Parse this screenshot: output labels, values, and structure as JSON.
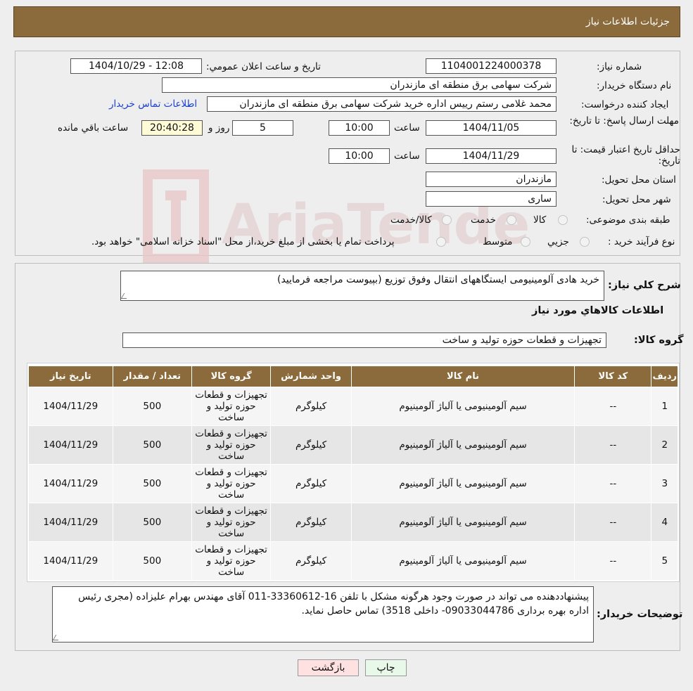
{
  "header": {
    "title": "جزئیات اطلاعات نیاز"
  },
  "form": {
    "need_number_label": "شماره نیاز:",
    "need_number": "1104001224000378",
    "announce_label": "تاریخ و ساعت اعلان عمومي:",
    "announce_value": "1404/10/29 - 12:08",
    "buyer_org_label": "نام دستگاه خريدار:",
    "buyer_org": "شرکت سهامی برق منطقه ای مازندران",
    "creator_label": "ايجاد کننده درخواست:",
    "creator": "محمد غلامی رستم رییس اداره خرید شرکت سهامی برق منطقه ای مازندران",
    "contact_link": "اطلاعات تماس خريدار",
    "reply_deadline_label": "مهلت ارسال پاسخ: تا تاريخ:",
    "reply_date": "1404/11/05",
    "time_label": "ساعت",
    "reply_time": "10:00",
    "days_value": "5",
    "days_label": "روز و",
    "remaining_time": "20:40:28",
    "remaining_label": "ساعت باقي مانده",
    "price_validity_label": "حداقل تاريخ اعتبار قيمت: تا تاريخ:",
    "validity_date": "1404/11/29",
    "validity_time": "10:00",
    "province_label": "استان محل تحويل:",
    "province": "مازندران",
    "city_label": "شهر محل تحويل:",
    "city": "ساری",
    "category_label": "طبقه بندی موضوعی:",
    "category_options": [
      "کالا",
      "خدمت",
      "کالا/خدمت"
    ],
    "process_label": "نوع فرآيند خريد :",
    "process_options": [
      "جزيي",
      "متوسط"
    ],
    "process_note": "پرداخت تمام يا بخشی از مبلغ خريد،از محل \"اسناد خزانه اسلامی\" خواهد بود."
  },
  "details": {
    "summary_label": "شرح کلي نياز:",
    "summary": "خرید هادی آلومینیومی ایستگاههای انتقال وفوق توزیع (بپیوست مراجعه فرمایید)",
    "goods_info_title": "اطلاعات کالاهاي مورد نياز",
    "goods_group_label": "گروه کالا:",
    "goods_group": "تجهیزات و قطعات حوزه تولید و ساخت",
    "table": {
      "headers": [
        "رديف",
        "کد کالا",
        "نام کالا",
        "واحد شمارش",
        "گروه کالا",
        "تعداد / مقدار",
        "تاريخ نياز"
      ],
      "rows": [
        [
          "1",
          "--",
          "سیم آلومینیومی یا آلیاژ آلومینیوم",
          "کیلوگرم",
          "تجهيزات و قطعات حوزه توليد و ساخت",
          "500",
          "1404/11/29"
        ],
        [
          "2",
          "--",
          "سیم آلومینیومی یا آلیاژ آلومینیوم",
          "کیلوگرم",
          "تجهيزات و قطعات حوزه توليد و ساخت",
          "500",
          "1404/11/29"
        ],
        [
          "3",
          "--",
          "سیم آلومینیومی یا آلیاژ آلومینیوم",
          "کیلوگرم",
          "تجهيزات و قطعات حوزه توليد و ساخت",
          "500",
          "1404/11/29"
        ],
        [
          "4",
          "--",
          "سیم آلومینیومی یا آلیاژ آلومینیوم",
          "کیلوگرم",
          "تجهيزات و قطعات حوزه توليد و ساخت",
          "500",
          "1404/11/29"
        ],
        [
          "5",
          "--",
          "سیم آلومینیومی یا آلیاژ آلومینیوم",
          "کیلوگرم",
          "تجهيزات و قطعات حوزه توليد و ساخت",
          "500",
          "1404/11/29"
        ]
      ]
    },
    "buyer_notes_label": "توضيحات خريدار:",
    "buyer_notes": "پیشنهاددهنده می تواند در صورت وجود هرگونه مشکل با تلفن 16-33360612-011 آقای مهندس بهرام علیزاده (مجری رئیس اداره بهره برداری  09033044786- داخلی 3518) تماس حاصل نماید."
  },
  "buttons": {
    "print": "چاپ",
    "back": "بازگشت"
  },
  "colors": {
    "header_bg": "#8b6a3b",
    "link": "#1a3fd1",
    "back_btn_bg": "#ffe1e1",
    "print_btn_bg": "#e9f9e9"
  }
}
